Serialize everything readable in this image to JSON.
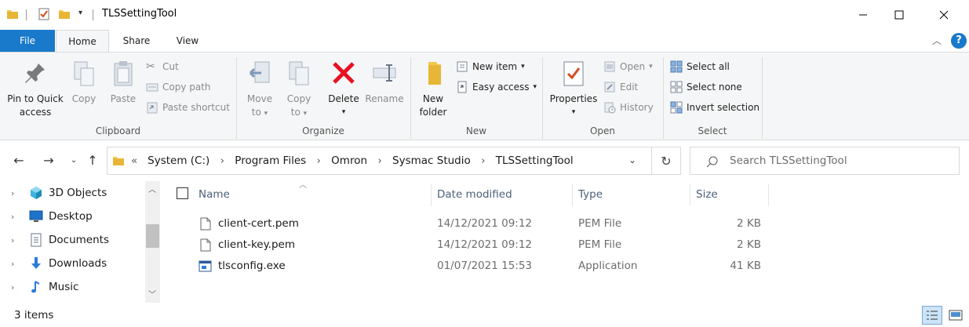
{
  "window": {
    "title": "TLSSettingTool"
  },
  "ribbon_tabs": [
    {
      "label": "File"
    },
    {
      "label": "Home"
    },
    {
      "label": "Share"
    },
    {
      "label": "View"
    }
  ],
  "ribbon": {
    "clipboard": {
      "label": "Clipboard",
      "pin_line1": "Pin to Quick",
      "pin_line2": "access",
      "copy": "Copy",
      "paste": "Paste",
      "cut": "Cut",
      "copy_path": "Copy path",
      "paste_shortcut": "Paste shortcut"
    },
    "organize": {
      "label": "Organize",
      "move_to_line1": "Move",
      "move_to_line2": "to",
      "copy_to_line1": "Copy",
      "copy_to_line2": "to",
      "delete": "Delete",
      "rename": "Rename"
    },
    "new": {
      "label": "New",
      "new_folder_line1": "New",
      "new_folder_line2": "folder",
      "new_item": "New item",
      "easy_access": "Easy access"
    },
    "open": {
      "label": "Open",
      "properties": "Properties",
      "open": "Open",
      "edit": "Edit",
      "history": "History"
    },
    "select": {
      "label": "Select",
      "select_all": "Select all",
      "select_none": "Select none",
      "invert_selection": "Invert selection"
    }
  },
  "address": {
    "overflow": "«",
    "crumbs": [
      "System (C:)",
      "Program Files",
      "Omron",
      "Sysmac Studio",
      "TLSSettingTool"
    ],
    "separator": "›"
  },
  "search": {
    "placeholder": "Search TLSSettingTool"
  },
  "nav_pane": {
    "items": [
      {
        "label": "3D Objects",
        "icon": "3d-objects-icon"
      },
      {
        "label": "Desktop",
        "icon": "desktop-icon"
      },
      {
        "label": "Documents",
        "icon": "documents-icon"
      },
      {
        "label": "Downloads",
        "icon": "downloads-icon"
      },
      {
        "label": "Music",
        "icon": "music-icon"
      }
    ]
  },
  "file_list": {
    "columns": {
      "name": "Name",
      "date_modified": "Date modified",
      "type": "Type",
      "size": "Size"
    },
    "rows": [
      {
        "name": "client-cert.pem",
        "date": "14/12/2021 09:12",
        "type": "PEM File",
        "size": "2 KB",
        "icon": "file-icon"
      },
      {
        "name": "client-key.pem",
        "date": "14/12/2021 09:12",
        "type": "PEM File",
        "size": "2 KB",
        "icon": "file-icon"
      },
      {
        "name": "tlsconfig.exe",
        "date": "01/07/2021 15:53",
        "type": "Application",
        "size": "41 KB",
        "icon": "application-icon"
      }
    ]
  },
  "status": {
    "item_count": "3 items"
  },
  "colors": {
    "file_tab": "#1979ca",
    "ribbon_bg": "#f5f6f7",
    "header_text": "#4c607a",
    "delete_red": "#e81123",
    "folder_yellow": "#f3c94b"
  }
}
